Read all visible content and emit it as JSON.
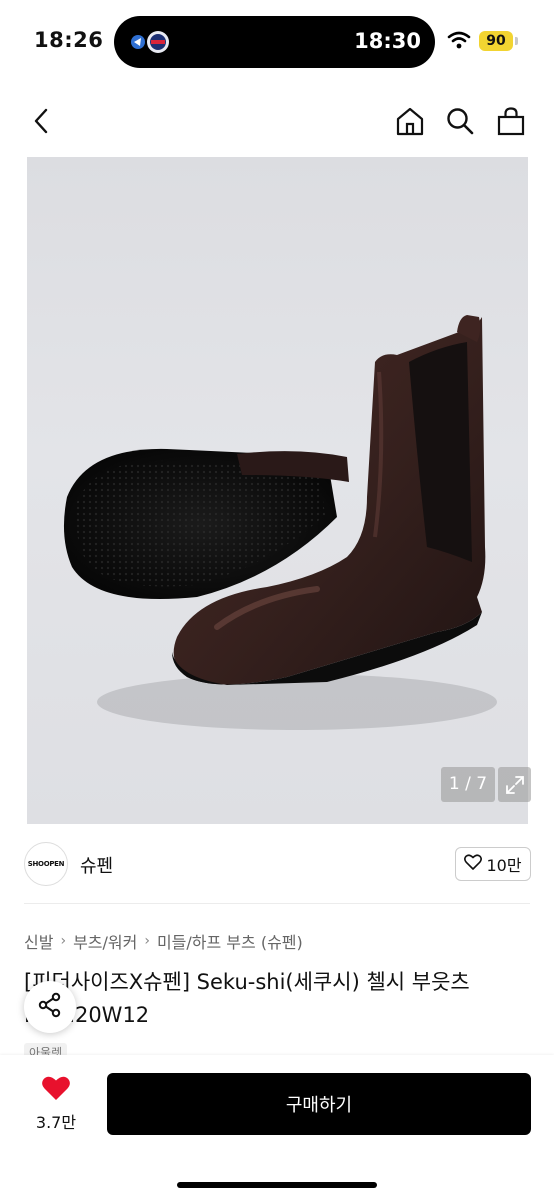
{
  "status_bar": {
    "left_time": "18:26",
    "island_time": "18:30",
    "battery": "90"
  },
  "nav": {
    "back_icon": "chevron-left-icon",
    "home_icon": "home-icon",
    "search_icon": "search-icon",
    "cart_icon": "shopping-bag-icon"
  },
  "gallery": {
    "pager": "1 / 7"
  },
  "shop": {
    "logo_text": "SHOOPEN",
    "name": "슈펜",
    "likes": "10만"
  },
  "breadcrumb": [
    "신발",
    "부츠/워커",
    "미들/하프 부츠 (슈펜)"
  ],
  "product": {
    "title": "[피더사이즈X슈펜] Seku-shi(세쿠시) 첼시 부읏츠 FWM20W12",
    "tag": "아울렛"
  },
  "bottom": {
    "wish_count": "3.7만",
    "buy_label": "구매하기"
  },
  "colors": {
    "heart": "#e8112d",
    "battery": "#f2d431"
  }
}
